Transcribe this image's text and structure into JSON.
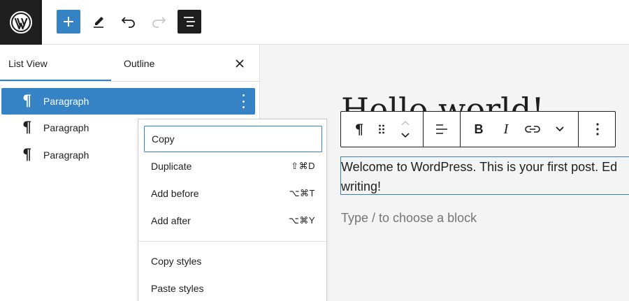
{
  "topbar": {
    "logo_icon": "wordpress-logo-icon",
    "add_icon": "plus-icon",
    "tools_icon": "pencil-icon",
    "undo_icon": "undo-icon",
    "redo_icon": "redo-icon",
    "list_view_icon": "list-view-icon",
    "accent_color": "#3582c4"
  },
  "panel": {
    "tabs": [
      {
        "label": "List View",
        "active": true
      },
      {
        "label": "Outline",
        "active": false
      }
    ],
    "close_icon": "close-icon",
    "rows": [
      {
        "icon": "paragraph-icon",
        "glyph": "¶",
        "label": "Paragraph",
        "selected": true
      },
      {
        "icon": "paragraph-icon",
        "glyph": "¶",
        "label": "Paragraph",
        "selected": false
      },
      {
        "icon": "paragraph-icon",
        "glyph": "¶",
        "label": "Paragraph",
        "selected": false
      }
    ]
  },
  "editor": {
    "title": "Hello world!",
    "paragraph": "Welcome to WordPress. This is your first post. Edit or delete it, then start writing!",
    "paragraph_line1": "Welcome to WordPress. This is your first post. Ed",
    "paragraph_line2": "writing!",
    "placeholder": "Type / to choose a block"
  },
  "block_toolbar": {
    "block_type_glyph": "¶",
    "items": [
      "paragraph-icon",
      "drag-handle-icon",
      "move-up-down-icon",
      "align-icon",
      "bold-icon",
      "italic-icon",
      "link-icon",
      "more-chevron-icon",
      "options-icon"
    ],
    "bold_glyph": "B",
    "italic_glyph": "I"
  },
  "context_menu": {
    "items": [
      {
        "label": "Copy",
        "shortcut": "",
        "focused": true
      },
      {
        "label": "Duplicate",
        "shortcut": "⇧⌘D"
      },
      {
        "label": "Add before",
        "shortcut": "⌥⌘T"
      },
      {
        "label": "Add after",
        "shortcut": "⌥⌘Y"
      }
    ],
    "style_items": [
      {
        "label": "Copy styles"
      },
      {
        "label": "Paste styles"
      }
    ]
  }
}
